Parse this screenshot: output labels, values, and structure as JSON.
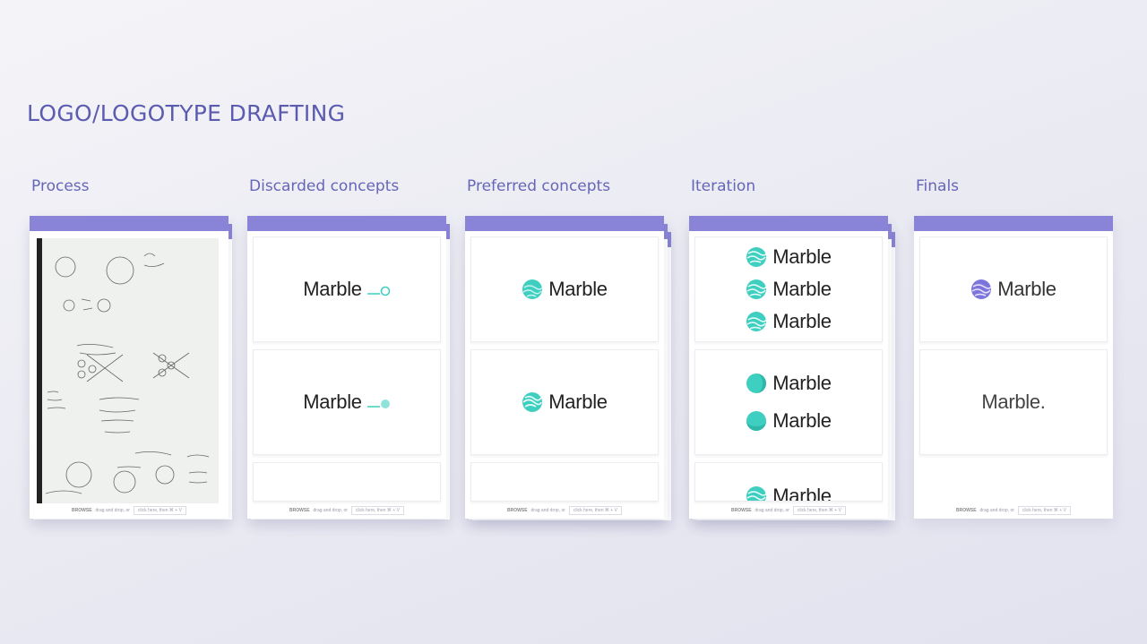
{
  "page": {
    "title": "LOGO/LOGOTYPE DRAFTING"
  },
  "columns": [
    {
      "title": "Process"
    },
    {
      "title": "Discarded concepts"
    },
    {
      "title": "Preferred concepts"
    },
    {
      "title": "Iteration"
    },
    {
      "title": "Finals"
    }
  ],
  "logo_word": "Marble",
  "final_word_dot": "Marble.",
  "drop": {
    "browse": "BROWSE",
    "text": "drag and drop, or",
    "box": "click here, then ⌘ + V"
  },
  "colors": {
    "accent": "#8a84d8",
    "teal": "#3fcfc0",
    "purple": "#7b75dc"
  }
}
